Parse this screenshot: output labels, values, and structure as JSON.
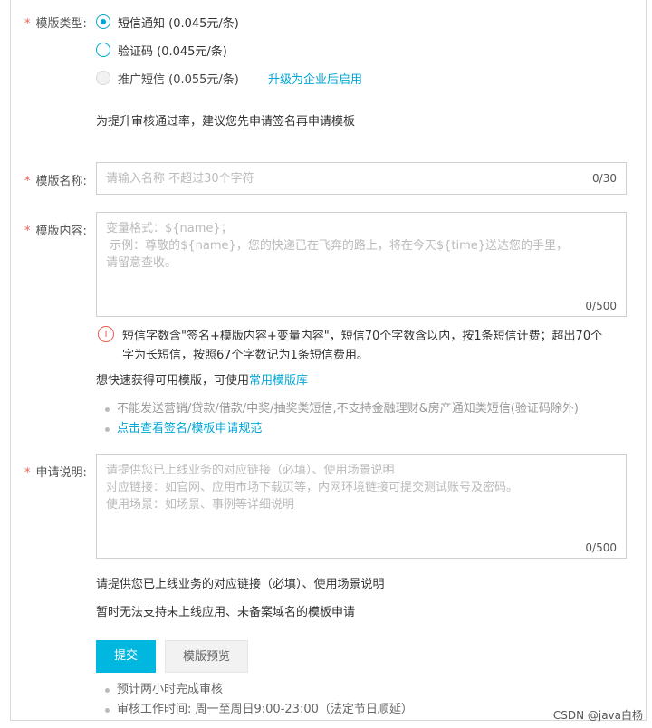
{
  "template_type": {
    "label": "模版类型:",
    "options": [
      {
        "label": "短信通知 (0.045元/条)",
        "checked": true,
        "disabled": false
      },
      {
        "label": "验证码 (0.045元/条)",
        "checked": false,
        "disabled": false
      },
      {
        "label": "推广短信 (0.055元/条)",
        "checked": false,
        "disabled": true
      }
    ],
    "upgrade_link": "升级为企业后启用",
    "tip": "为提升审核通过率，建议您先申请签名再申请模板"
  },
  "template_name": {
    "label": "模版名称:",
    "placeholder": "请输入名称 不超过30个字符",
    "counter": "0/30"
  },
  "template_content": {
    "label": "模版内容:",
    "placeholder_lines": [
      "变量格式：${name}；",
      " 示例：尊敬的${name}，您的快递已在飞奔的路上，将在今天${time}送达您的手里，",
      "请留意查收。"
    ],
    "counter": "0/500",
    "warning_line1": "短信字数含\"签名+模版内容+变量内容\"，短信70个字数含以内，按1条短信计费；超出70个",
    "warning_line2": "字为长短信，按照67个字数记为1条短信费用。",
    "quick_prefix": "想快速获得可用模版，可使用",
    "quick_link": "常用模版库",
    "rules": [
      "不能发送营销/贷款/借款/中奖/抽奖类短信,不支持金融理财&房产通知类短信(验证码除外)"
    ],
    "rules_link": "点击查看签名/模板申请规范"
  },
  "apply_desc": {
    "label": "申请说明:",
    "placeholder_lines": [
      "请提供您已上线业务的对应链接（必填）、使用场景说明",
      "对应链接：如官网、应用市场下载页等，内网环境链接可提交测试账号及密码。",
      "使用场景：如场景、事例等详细说明"
    ],
    "counter": "0/500",
    "note1": "请提供您已上线业务的对应链接（必填）、使用场景说明",
    "note2": "暂时无法支持未上线应用、未备案域名的模板申请"
  },
  "actions": {
    "submit": "提交",
    "preview": "模版预览",
    "info": [
      "预计两小时完成审核",
      "审核工作时间: 周一至周日9:00-23:00（法定节日顺延）"
    ]
  },
  "watermark": "CSDN @java白杨",
  "colors": {
    "accent": "#00a6d6",
    "required": "#e85f4e",
    "primary_button": "#00b7e0"
  }
}
